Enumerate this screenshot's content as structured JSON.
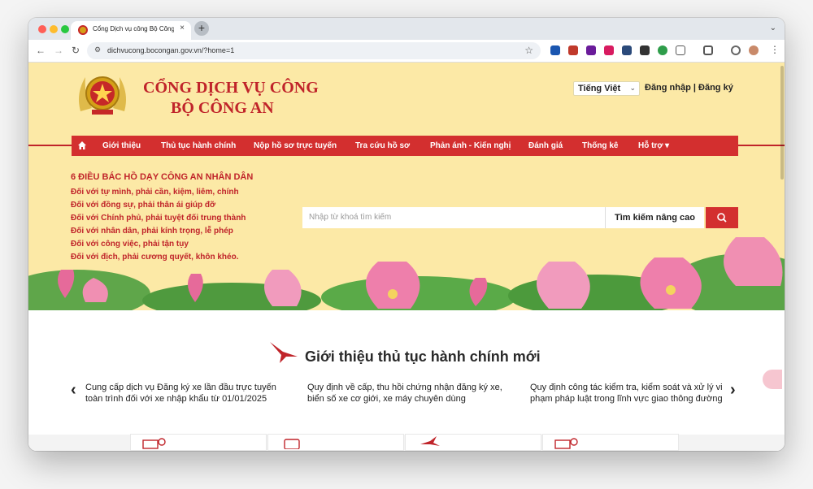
{
  "browser": {
    "tab_title": "Cổng Dịch vụ công Bộ Công an",
    "new_tab": "+",
    "tab_close": "×",
    "url": "dichvucong.bocongan.gov.vn/?home=1"
  },
  "header": {
    "brand_line1": "CỔNG DỊCH VỤ CÔNG",
    "brand_line2": "BỘ CÔNG AN",
    "language": "Tiếng Việt",
    "auth": "Đăng nhập | Đăng ký"
  },
  "nav": {
    "items": [
      "Giới thiệu",
      "Thủ tục hành chính",
      "Nộp hồ sơ trực tuyến",
      "Tra cứu hồ sơ",
      "Phản ánh - Kiến nghị",
      "Đánh giá",
      "Thống kê",
      "Hỗ trợ"
    ]
  },
  "teachings": {
    "title": "6 ĐIỀU BÁC HỒ DẠY CÔNG AN NHÂN DÂN",
    "lines": [
      "Đối với tự mình, phải cần, kiệm, liêm, chính",
      "Đối với đồng sự, phải thân ái giúp đỡ",
      "Đối với Chính phủ, phải tuyệt đối trung thành",
      "Đối với nhân dân, phải kính trọng, lễ phép",
      "Đối với công việc, phải tận tụy",
      "Đối với địch, phải cương quyết, khôn khéo."
    ]
  },
  "search": {
    "placeholder": "Nhập từ khoá tìm kiếm",
    "advanced": "Tìm kiếm nâng cao"
  },
  "section": {
    "title": "Giới thiệu thủ tục hành chính mới",
    "news": [
      {
        "line1": "Cung cấp dịch vụ Đăng ký xe lần đầu trực tuyến",
        "line2": "toàn trình đối với xe nhập khẩu từ 01/01/2025"
      },
      {
        "line1": "Quy định về cấp, thu hồi chứng nhận đăng ký xe,",
        "line2": "biển số xe cơ giới, xe máy chuyên dùng"
      },
      {
        "line1": "Quy định công tác kiểm tra, kiểm soát và xử lý vi",
        "line2": "phạm pháp luật trong lĩnh vực giao thông đường"
      }
    ]
  },
  "colors": {
    "brand_red": "#c0242a",
    "nav_red": "#d32f2f",
    "banner_yellow": "#fce9a6"
  }
}
